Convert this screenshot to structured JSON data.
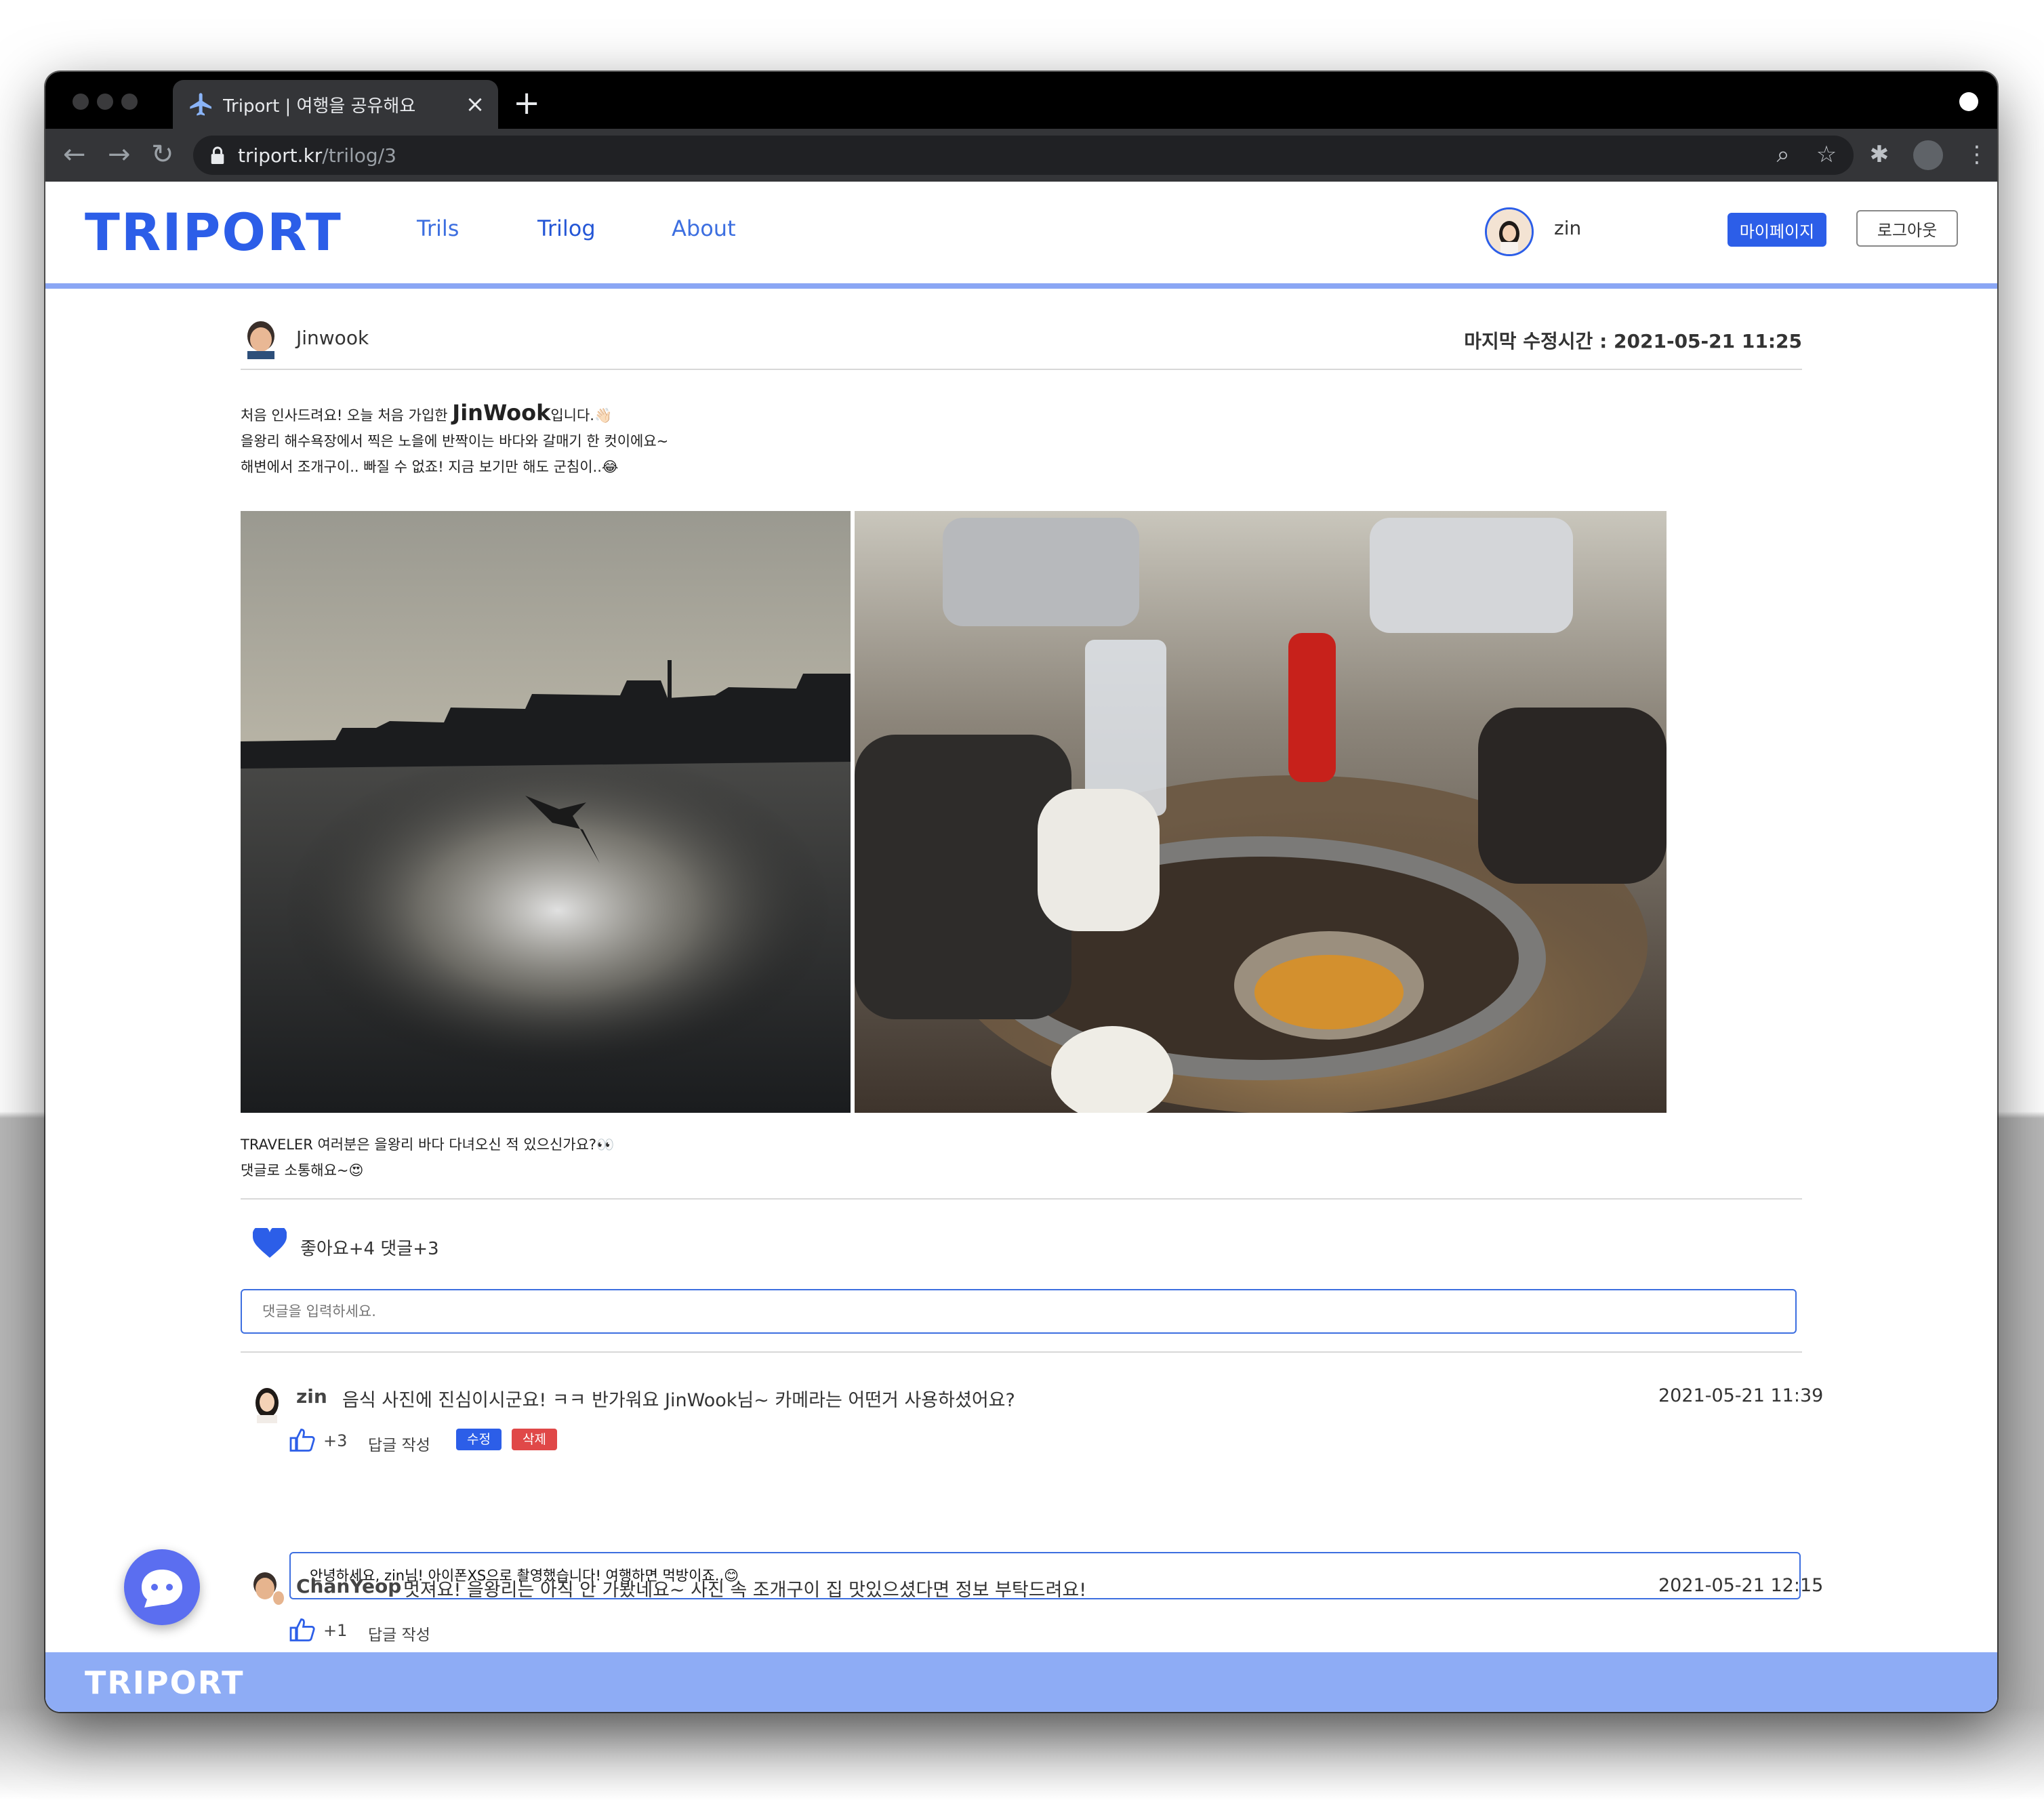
{
  "browser": {
    "tab_title": "Triport | 여행을 공유해요",
    "url_host": "triport.kr",
    "url_path": "/trilog/3",
    "close_glyph": "×",
    "new_tab_glyph": "+"
  },
  "header": {
    "logo": "TRIPORT",
    "nav": [
      "Trils",
      "Trilog",
      "About"
    ],
    "username": "zin",
    "mypage_label": "마이페이지",
    "logout_label": "로그아웃"
  },
  "post": {
    "author": "Jinwook",
    "modified": "마지막 수정시간 : 2021-05-21 11:25",
    "line1_pre": "처음 인사드려요! 오늘 처음 가입한 ",
    "line1_big": "JinWook",
    "line1_post": "입니다.👋🏻",
    "line2": "을왕리 해수욕장에서 찍은 노을에 반짝이는 바다와 갈매기 한 컷이에요~",
    "line3": "해변에서 조개구이.. 빠질 수 없죠! 지금 보기만 해도 군침이..😂",
    "line4": "TRAVELER 여러분은 을왕리 바다 다녀오신 적 있으신가요?👀",
    "line5": "댓글로 소통해요~😍",
    "stats": "좋아요+4  댓글+3",
    "comment_placeholder": "댓글을 입력하세요."
  },
  "comments": [
    {
      "name": "zin",
      "text": "음식 사진에 진심이시군요! ㅋㅋ 반가워요 JinWook님~ 카메라는 어떤거 사용하셨어요?",
      "date": "2021-05-21 11:39",
      "likes": "+3",
      "reply_label": "답글 작성",
      "edit_label": "수정",
      "delete_label": "삭제",
      "reply_draft": "안녕하세요, zin님! 아이폰XS으로 촬영했습니다! 여행하면 먹방이죠..😊"
    },
    {
      "name": "ChanYeop",
      "text": "멋져요! 을왕리는 아직 안 가봤네요~ 사진 속 조개구이 집 맛있으셨다면 정보 부탁드려요!",
      "date": "2021-05-21 12:15",
      "likes": "+1",
      "reply_label": "답글 작성"
    }
  ],
  "footer": {
    "logo": "TRIPORT"
  },
  "colors": {
    "brand": "#2c5ee8",
    "footer": "#8eacf5",
    "delete": "#e04848",
    "chat": "#5b6ef0"
  }
}
